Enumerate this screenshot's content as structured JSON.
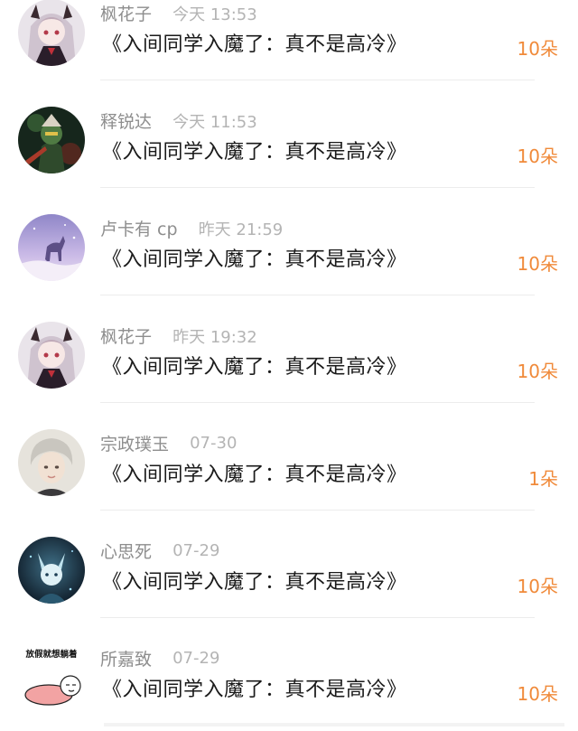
{
  "rows": [
    {
      "name": "枫花子",
      "time": "今天 13:53",
      "book": "《入间同学入魔了：真不是高冷》",
      "gift": "10朵",
      "avatar": "anime-girl-avatar-icon"
    },
    {
      "name": "释锐达",
      "time": "今天 11:53",
      "book": "《入间同学入魔了：真不是高冷》",
      "gift": "10朵",
      "avatar": "green-warrior-avatar-icon"
    },
    {
      "name": "卢卡有 cp",
      "time": "昨天 21:59",
      "book": "《入间同学入魔了：真不是高冷》",
      "gift": "10朵",
      "avatar": "unicorn-avatar-icon"
    },
    {
      "name": "枫花子",
      "time": "昨天 19:32",
      "book": "《入间同学入魔了：真不是高冷》",
      "gift": "10朵",
      "avatar": "anime-girl-avatar-icon"
    },
    {
      "name": "宗政璞玉",
      "time": "07-30",
      "book": "《入间同学入魔了：真不是高冷》",
      "gift": "1朵",
      "avatar": "silver-hair-avatar-icon"
    },
    {
      "name": "心思死",
      "time": "07-29",
      "book": "《入间同学入魔了：真不是高冷》",
      "gift": "10朵",
      "avatar": "fox-avatar-icon"
    },
    {
      "name": "所嘉致",
      "time": "07-29",
      "book": "《入间同学入魔了：真不是高冷》",
      "gift": "10朵",
      "avatar": "lying-down-sticker-icon",
      "avatar_caption": "放假就想躺着"
    }
  ],
  "colors": {
    "gift": "#f08a3a",
    "name": "#8e8e8e",
    "time": "#b4b4b4",
    "book": "#1a1a1a"
  }
}
